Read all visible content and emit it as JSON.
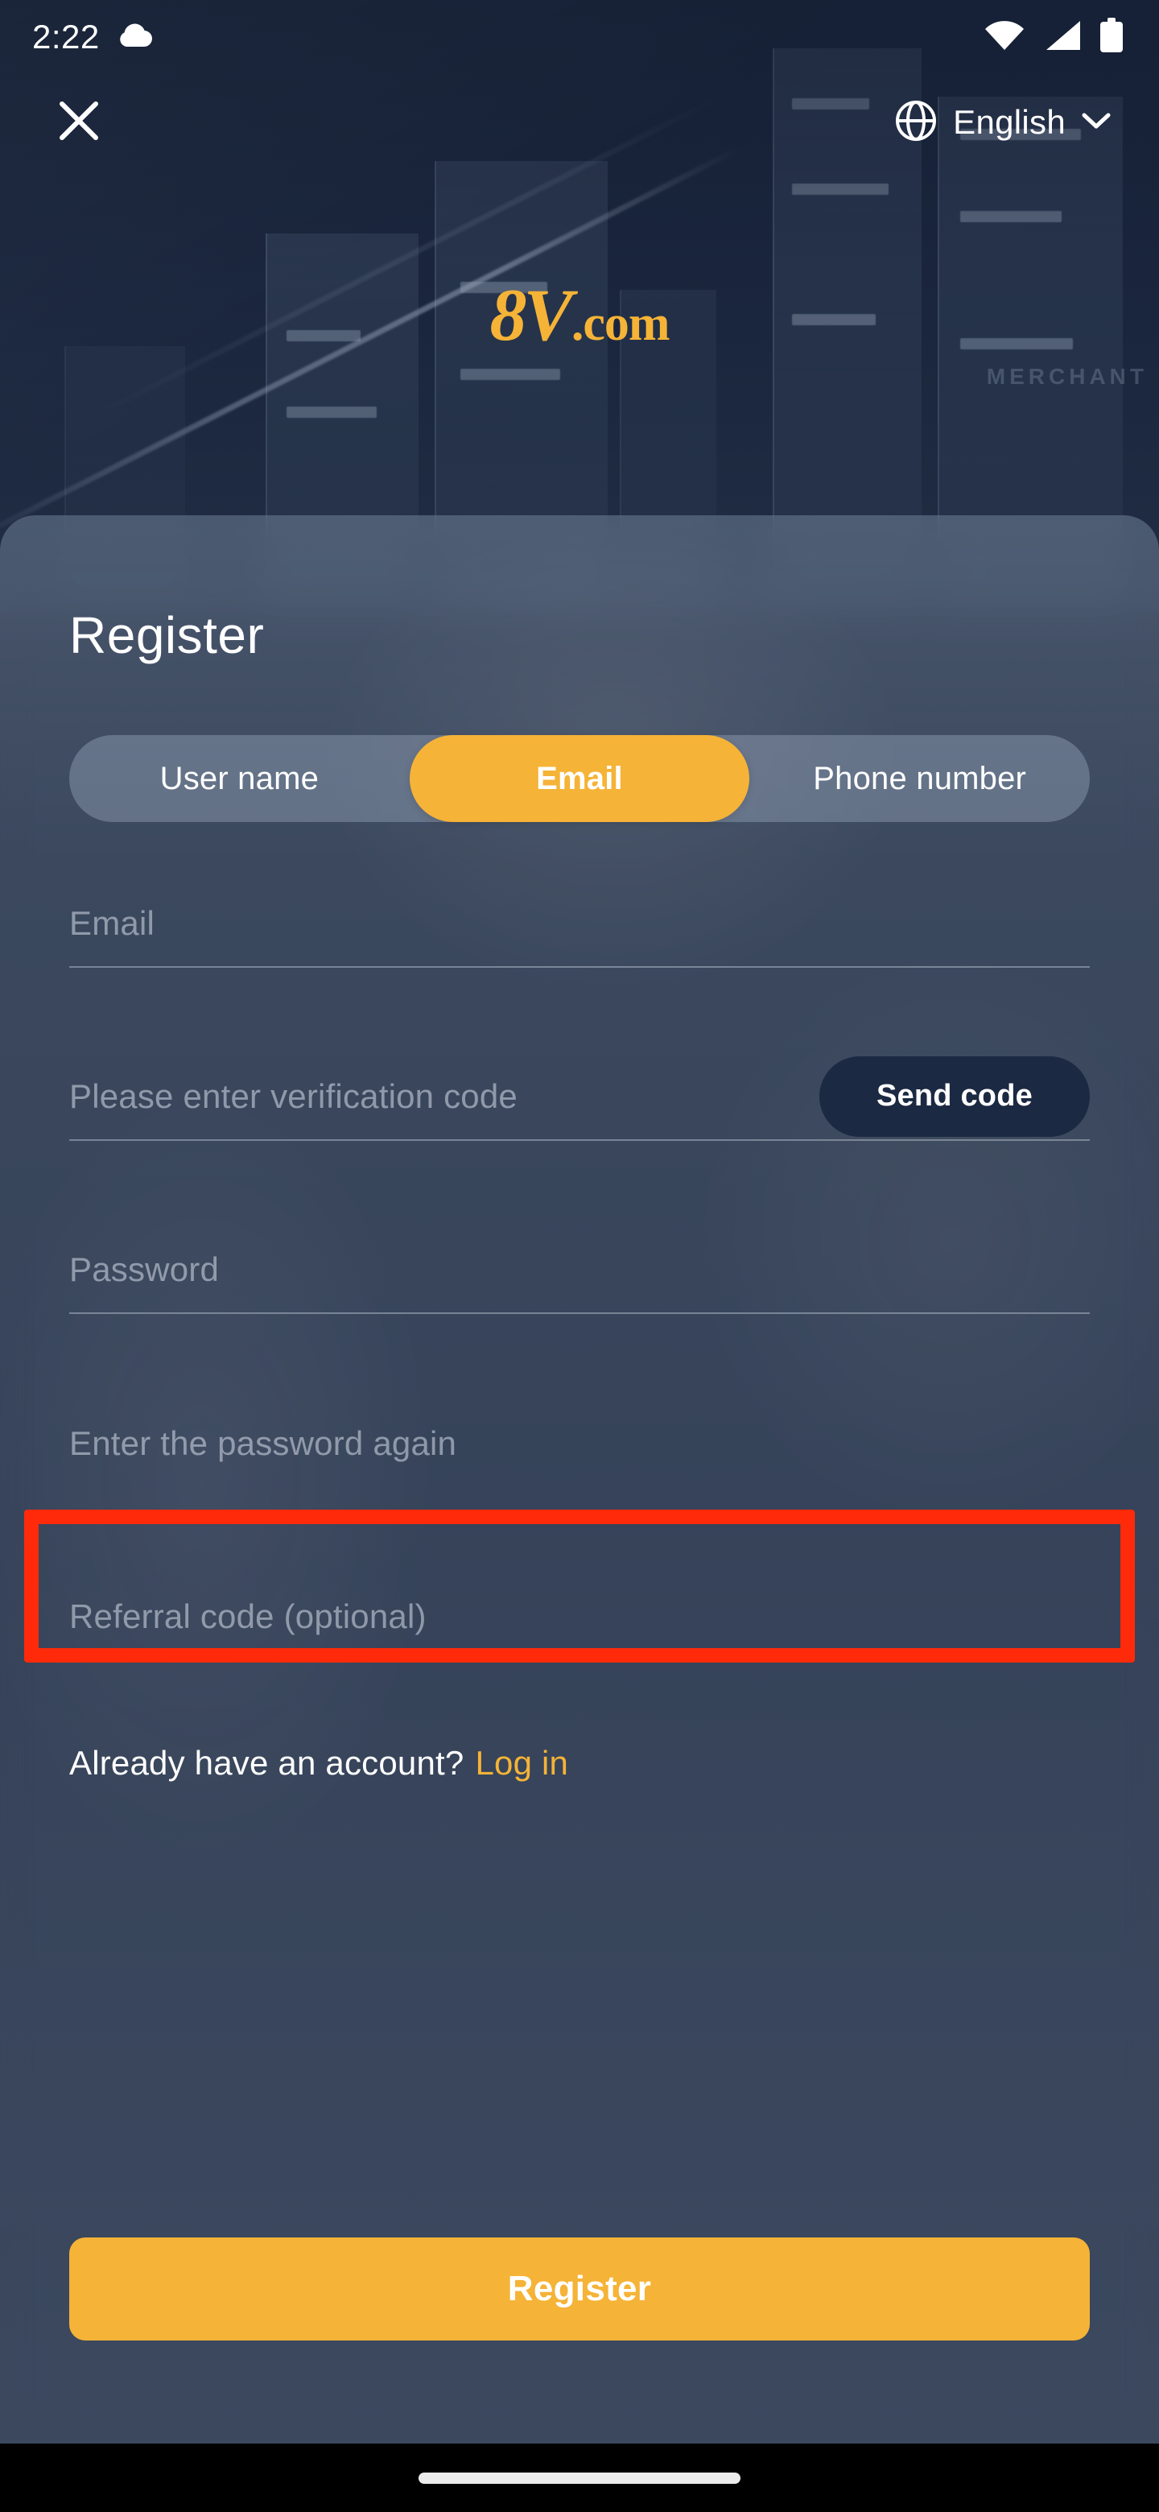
{
  "status_bar": {
    "time": "2:22",
    "weather_icon": "cloud-icon",
    "wifi_icon": "wifi-icon",
    "signal_icon": "cellular-signal-icon",
    "battery_icon": "battery-icon"
  },
  "top_nav": {
    "close_icon": "close-icon",
    "globe_icon": "globe-icon",
    "language": "English",
    "chevron_icon": "chevron-down-icon"
  },
  "brand": {
    "logo_mark": "8V",
    "logo_suffix": ".com",
    "logo_color": "#F5B337",
    "background_watermark": "MERCHANT"
  },
  "register_card": {
    "title": "Register",
    "tabs": [
      {
        "label": "User name",
        "active": false
      },
      {
        "label": "Email",
        "active": true
      },
      {
        "label": "Phone number",
        "active": false
      }
    ],
    "fields": {
      "email": {
        "value": "",
        "placeholder": "Email"
      },
      "verification_code": {
        "value": "",
        "placeholder": "Please enter verification code"
      },
      "password": {
        "value": "",
        "placeholder": "Password"
      },
      "password_confirm": {
        "value": "",
        "placeholder": "Enter the password again"
      },
      "referral_code": {
        "value": "",
        "placeholder": "Referral code (optional)"
      }
    },
    "send_code_label": "Send code",
    "login_prompt": "Already have an account?",
    "login_link": "Log in",
    "submit_label": "Register"
  },
  "annotation": {
    "target": "referral-code-field",
    "color": "#FF2A0A"
  },
  "theme": {
    "accent": "#F5B337",
    "card_overlay": "#6E8098",
    "hero_bg": "#1b2840",
    "send_code_bg": "#1B2942"
  }
}
